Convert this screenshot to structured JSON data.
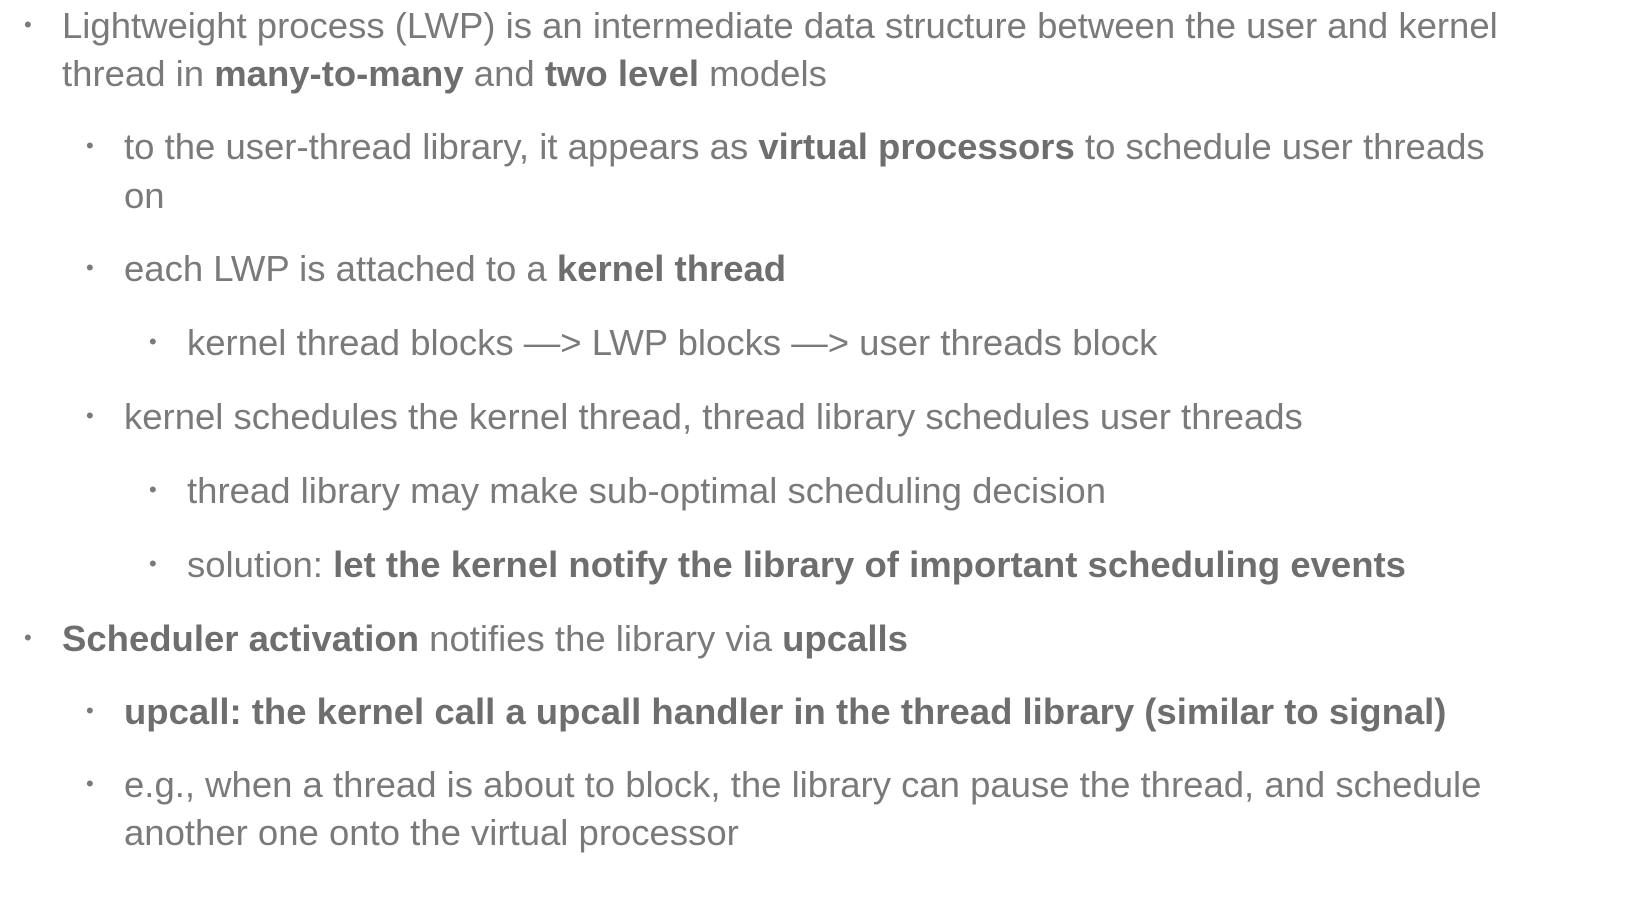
{
  "bullets": [
    {
      "bullet_glyph": "•",
      "line1": [
        "Lightweight process (LWP) is an intermediate data structure between the user and kernel"
      ],
      "line2": [
        "thread in ",
        "many-to-many",
        " and ",
        "two level",
        " models"
      ]
    },
    {
      "bullet_glyph": "•",
      "line1": [
        "to the user-thread library, it appears as ",
        "virtual processors",
        " to schedule user threads"
      ],
      "line2": [
        "on"
      ]
    },
    {
      "bullet_glyph": "•",
      "line1": [
        "each LWP is attached to a ",
        "kernel thread"
      ]
    },
    {
      "bullet_glyph": "•",
      "line1": [
        "kernel thread blocks —> LWP blocks —> user threads block"
      ]
    },
    {
      "bullet_glyph": "•",
      "line1": [
        "kernel schedules the kernel thread, thread library schedules user threads"
      ]
    },
    {
      "bullet_glyph": "•",
      "line1": [
        "thread library may make sub-optimal scheduling decision"
      ]
    },
    {
      "bullet_glyph": "•",
      "line1": [
        "solution: ",
        "let the kernel notify the library of important scheduling events"
      ]
    },
    {
      "bullet_glyph": "•",
      "line1": [
        "Scheduler activation",
        " notifies the library via ",
        "upcalls"
      ]
    },
    {
      "bullet_glyph": "•",
      "line1": [
        "upcall: the kernel call a upcall handler in the thread library (similar to signal)"
      ]
    },
    {
      "bullet_glyph": "•",
      "line1": [
        "e.g., when a thread is about to block, the library can pause the thread, and schedule"
      ],
      "line2": [
        "another one onto the virtual processor"
      ]
    }
  ]
}
